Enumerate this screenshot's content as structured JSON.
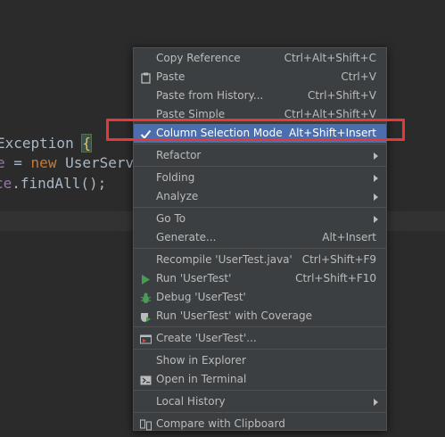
{
  "editor": {
    "lines": [
      {
        "parts": [
          {
            "t": "Exception ",
            "c": "plain"
          },
          {
            "t": "{",
            "c": "brace"
          }
        ]
      },
      {
        "parts": [
          {
            "t": "e",
            "c": "var"
          },
          {
            "t": " = ",
            "c": "plain"
          },
          {
            "t": "new",
            "c": "kw"
          },
          {
            "t": " UserServ",
            "c": "plain"
          }
        ]
      },
      {
        "parts": [
          {
            "t": "ce",
            "c": "var"
          },
          {
            "t": ".findAll();",
            "c": "plain"
          }
        ]
      }
    ]
  },
  "menu": {
    "items": [
      {
        "label": "Copy Reference",
        "shortcut": "Ctrl+Alt+Shift+C"
      },
      {
        "label": "Paste",
        "shortcut": "Ctrl+V",
        "icon": "clipboard-icon"
      },
      {
        "label": "Paste from History...",
        "shortcut": "Ctrl+Shift+V"
      },
      {
        "label": "Paste Simple",
        "shortcut": "Ctrl+Alt+Shift+V"
      },
      {
        "label": "Column Selection Mode",
        "shortcut": "Alt+Shift+Insert",
        "icon": "checkmark-icon",
        "selected": true
      },
      {
        "label": "Refactor",
        "submenu": true
      },
      {
        "label": "Folding",
        "submenu": true
      },
      {
        "label": "Analyze",
        "submenu": true
      },
      {
        "label": "Go To",
        "submenu": true
      },
      {
        "label": "Generate...",
        "shortcut": "Alt+Insert"
      },
      {
        "label": "Recompile 'UserTest.java'",
        "shortcut": "Ctrl+Shift+F9"
      },
      {
        "label": "Run 'UserTest'",
        "shortcut": "Ctrl+Shift+F10",
        "icon": "run-icon"
      },
      {
        "label": "Debug 'UserTest'",
        "icon": "debug-icon"
      },
      {
        "label": "Run 'UserTest' with Coverage",
        "icon": "coverage-icon"
      },
      {
        "label": "Create 'UserTest'...",
        "icon": "create-config-icon"
      },
      {
        "label": "Show in Explorer"
      },
      {
        "label": "Open in Terminal",
        "icon": "terminal-icon"
      },
      {
        "label": "Local History",
        "submenu": true
      },
      {
        "label": "Compare with Clipboard",
        "icon": "compare-icon"
      }
    ]
  },
  "colors": {
    "editor_bg": "#2b2b2b",
    "menu_bg": "#3c3f41",
    "selection": "#4b6eaf",
    "highlight_box": "#e53935"
  }
}
